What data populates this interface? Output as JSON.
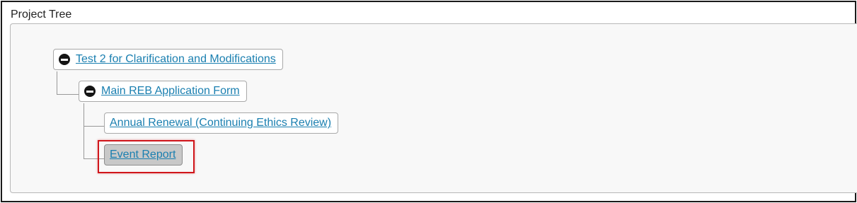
{
  "panel": {
    "title": "Project Tree"
  },
  "tree": {
    "nodes": [
      {
        "label": "Test 2 for Clarification and Modifications",
        "level": 0,
        "expanded": true,
        "selected": false
      },
      {
        "label": "Main REB Application Form",
        "level": 1,
        "expanded": true,
        "selected": false
      },
      {
        "label": "Annual Renewal (Continuing Ethics Review)",
        "level": 2,
        "expanded": false,
        "selected": false
      },
      {
        "label": "Event Report",
        "level": 2,
        "expanded": false,
        "selected": true
      }
    ]
  },
  "colors": {
    "link": "#1a7fb0",
    "selected_bg": "#c8c8c8",
    "highlight": "#d0161b",
    "panel_bg": "#f8f8f8"
  },
  "icons": {
    "collapse": "minus-circle-icon"
  }
}
